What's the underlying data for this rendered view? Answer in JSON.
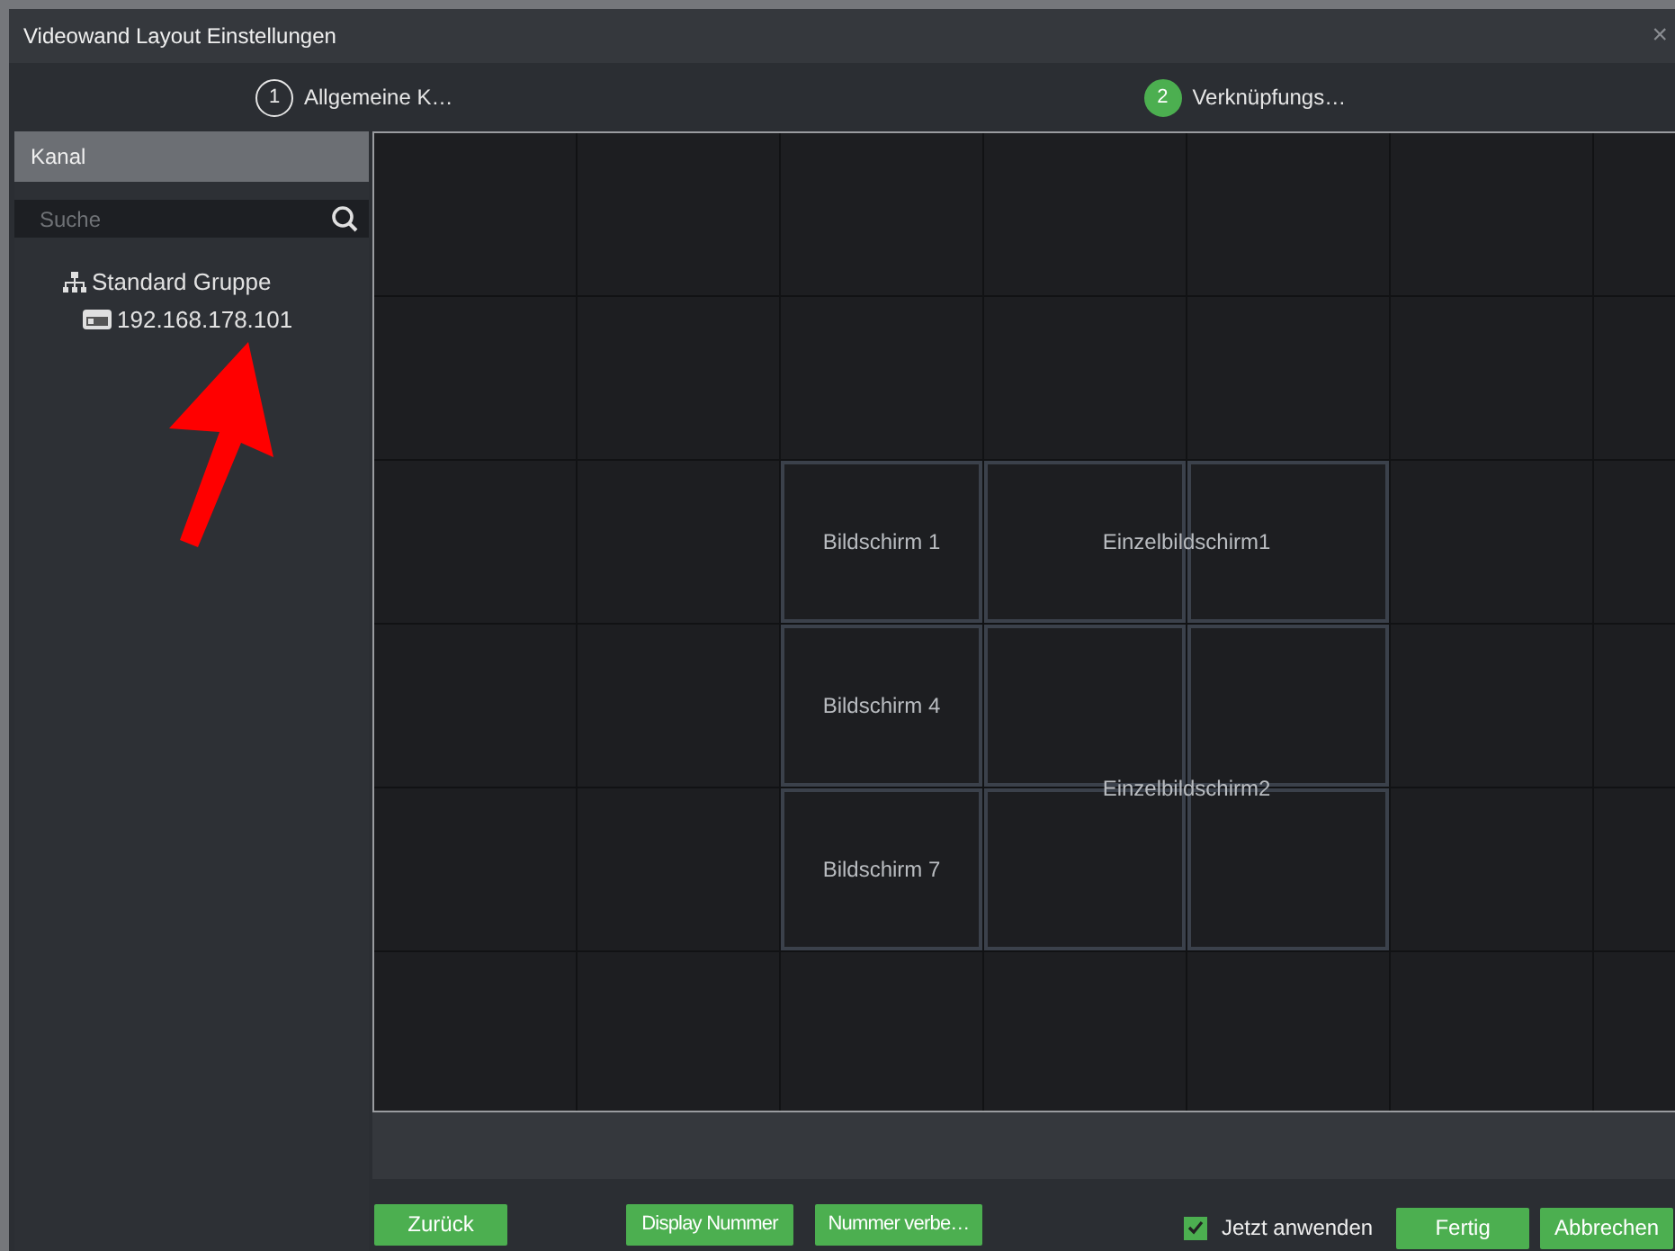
{
  "window": {
    "title": "Videowand Layout Einstellungen",
    "close": "×"
  },
  "steps": [
    {
      "number": "1",
      "label": "Allgemeine K…",
      "selected": false
    },
    {
      "number": "2",
      "label": "Verknüpfungs…",
      "selected": true
    }
  ],
  "sidebar": {
    "header": "Kanal",
    "search": {
      "placeholder": "Suche"
    },
    "tree": [
      {
        "label": "Standard Gruppe",
        "kind": "group",
        "children": [
          {
            "label": "192.168.178.101",
            "kind": "device"
          }
        ]
      }
    ]
  },
  "wall": {
    "rows": [
      [
        {
          "kind": "empty"
        },
        {
          "kind": "empty"
        },
        {
          "kind": "empty"
        },
        {
          "kind": "empty"
        },
        {
          "kind": "empty"
        },
        {
          "kind": "empty"
        },
        {
          "kind": "empty"
        }
      ],
      [
        {
          "kind": "empty"
        },
        {
          "kind": "empty"
        },
        {
          "kind": "empty"
        },
        {
          "kind": "empty"
        },
        {
          "kind": "empty"
        },
        {
          "kind": "empty"
        },
        {
          "kind": "empty"
        }
      ],
      [
        {
          "kind": "empty"
        },
        {
          "kind": "empty"
        },
        {
          "kind": "screen",
          "label": "Bildschirm 1"
        },
        {
          "kind": "joined",
          "label": "Einzelbildschirm1"
        },
        {
          "kind": "joined"
        },
        {
          "kind": "empty"
        },
        {
          "kind": "empty"
        }
      ],
      [
        {
          "kind": "empty"
        },
        {
          "kind": "empty"
        },
        {
          "kind": "screen",
          "label": "Bildschirm 4"
        },
        {
          "kind": "joined",
          "label": "Einzelbildschirm2"
        },
        {
          "kind": "joined"
        },
        {
          "kind": "empty"
        },
        {
          "kind": "empty"
        }
      ],
      [
        {
          "kind": "empty"
        },
        {
          "kind": "empty"
        },
        {
          "kind": "screen",
          "label": "Bildschirm 7"
        },
        {
          "kind": "joined"
        },
        {
          "kind": "joined"
        },
        {
          "kind": "empty"
        },
        {
          "kind": "empty"
        }
      ],
      [
        {
          "kind": "empty"
        },
        {
          "kind": "empty"
        },
        {
          "kind": "empty"
        },
        {
          "kind": "empty"
        },
        {
          "kind": "empty"
        },
        {
          "kind": "empty"
        },
        {
          "kind": "empty"
        }
      ]
    ]
  },
  "footer": {
    "back": "Zurück",
    "tools": [
      "Display Nummer",
      "Nummer verbe…"
    ],
    "apply_now": {
      "label": "Jetzt anwenden",
      "checked": true
    },
    "actions": [
      "Fertig",
      "Abbrechen"
    ]
  }
}
